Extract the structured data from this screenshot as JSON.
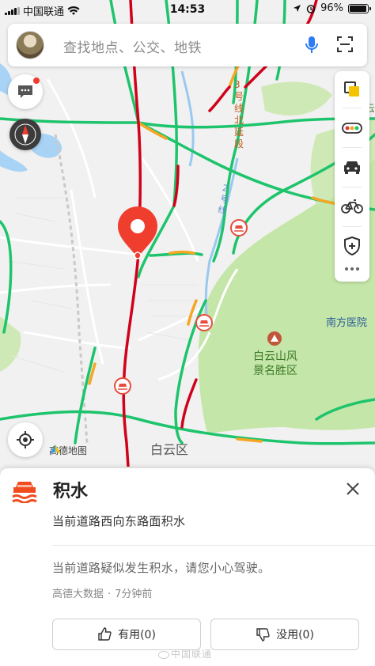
{
  "status_bar": {
    "carrier": "中国联通",
    "time": "14:53",
    "battery": "96%",
    "battery_level": 0.96
  },
  "search": {
    "placeholder": "查找地点、公交、地铁"
  },
  "map": {
    "metro_line_3": "3号线北延段",
    "metro_line_2": "2号线",
    "poi_scenic": "白云山风景名胜区",
    "poi_scenic_line1": "白云山风",
    "poi_scenic_line2": "景名胜区",
    "poi_hospital": "南方医院",
    "poi_corner": "云",
    "district": "白云区",
    "logo": "高德地图",
    "colors": {
      "traffic_smooth": "#1ec46c",
      "traffic_slow": "#f5a623",
      "traffic_jam": "#d0021b",
      "park_green": "#c4e6a8",
      "water": "#a9d3f5",
      "metro": "#9ac8f0",
      "marker": "#f03e2e"
    }
  },
  "card": {
    "title": "积水",
    "subtitle": "当前道路西向东路面积水",
    "description": "当前道路疑似发生积水，请您小心驾驶。",
    "source": "高德大数据",
    "time_ago": "7分钟前",
    "useful_button": "有用(0)",
    "useless_button": "没用(0)",
    "watermark": "中国联通",
    "icon": "waterlogging-car-icon",
    "accent": "#f04c1e"
  }
}
